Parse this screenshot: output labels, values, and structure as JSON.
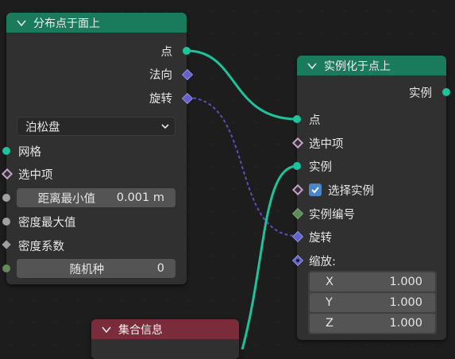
{
  "colors": {
    "teal_header": "#1a7a5c",
    "red_header": "#7b2c3b",
    "geometry_socket": "#1dc39b",
    "vector_socket": "#6363c7",
    "bool_socket": "#c79ec7",
    "int_socket": "#63895c",
    "wire_teal": "#1dc39b",
    "wire_purple": "#6a5acd"
  },
  "node_distribute": {
    "title": "分布点于面上",
    "outputs": [
      "点",
      "法向",
      "旋转"
    ],
    "mode_value": "泊松盘",
    "inputs": {
      "mesh": "网格",
      "selection": "选中项",
      "distance_min_label": "距离最小值",
      "distance_min_value": "0.001 m",
      "density_max": "密度最大值",
      "density_factor": "密度系数",
      "seed_label": "随机种",
      "seed_value": "0"
    }
  },
  "node_instance": {
    "title": "实例化于点上",
    "output": "实例",
    "inputs": {
      "points": "点",
      "selection": "选中项",
      "instance": "实例",
      "pick_instance": "选择实例",
      "pick_instance_checked": true,
      "instance_index": "实例编号",
      "rotation": "旋转",
      "scale": "缩放:",
      "scale_x_label": "X",
      "scale_x_value": "1.000",
      "scale_y_label": "Y",
      "scale_y_value": "1.000",
      "scale_z_label": "Z",
      "scale_z_value": "1.000"
    }
  },
  "node_collection": {
    "title": "集合信息"
  }
}
